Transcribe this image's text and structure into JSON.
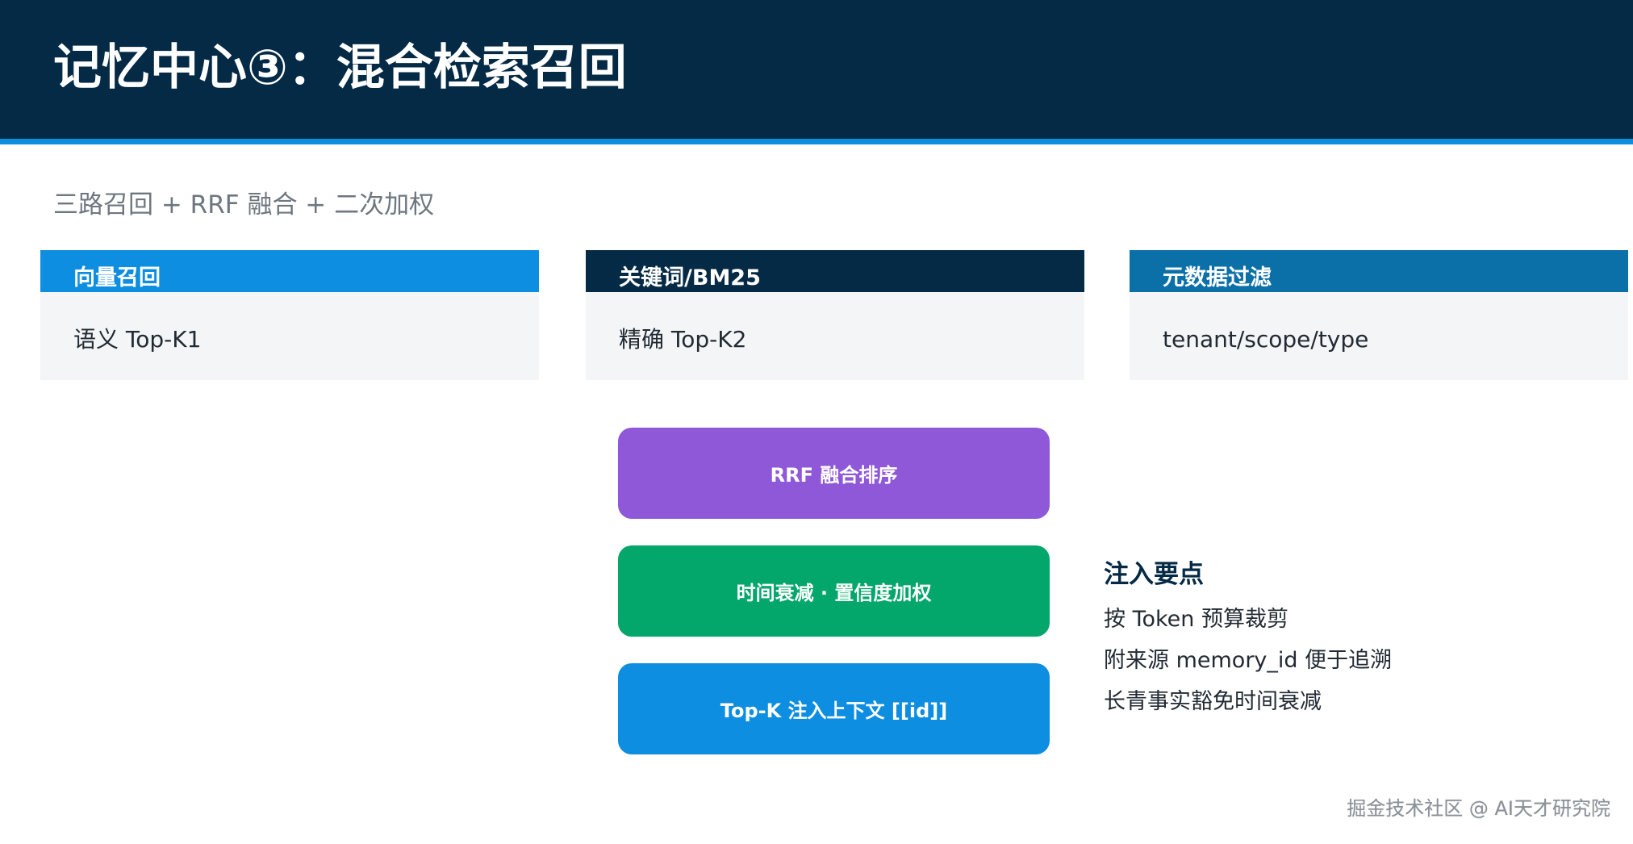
{
  "header": {
    "title": "记忆中心③：混合检索召回",
    "background": "#052a45",
    "rule_color": "#0d8ee0"
  },
  "subtitle": "三路召回 + RRF 融合 + 二次加权",
  "cards": [
    {
      "title": "向量召回",
      "body": "语义 Top-K1",
      "head_color": "#0d8ee0"
    },
    {
      "title": "关键词/BM25",
      "body": "精确 Top-K2",
      "head_color": "#052a45"
    },
    {
      "title": "元数据过滤",
      "body": "tenant/scope/type",
      "head_color": "#0b6fa8"
    }
  ],
  "steps": [
    {
      "label": "RRF 融合排序",
      "color": "#8e58d8"
    },
    {
      "label": "时间衰减 · 置信度加权",
      "color": "#03a66b"
    },
    {
      "label": "Top-K 注入上下文 [[id]]",
      "color": "#0d8ee0"
    }
  ],
  "notes": {
    "title": "注入要点",
    "items": [
      "按 Token 预算裁剪",
      "附来源 memory_id 便于追溯",
      "长青事实豁免时间衰减"
    ]
  },
  "footer": "掘金技术社区 @ AI天才研究院"
}
